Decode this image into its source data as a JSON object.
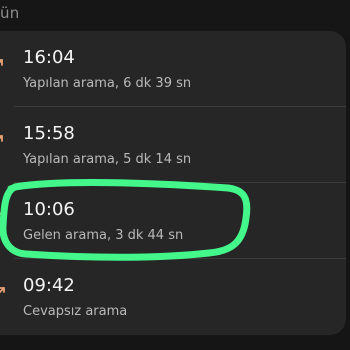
{
  "header": {
    "section_label": "ün"
  },
  "calls": [
    {
      "time": "16:04",
      "detail": "Yapılan arama, 6 dk 39 sn",
      "icon": "outgoing-call-icon"
    },
    {
      "time": "15:58",
      "detail": "Yapılan arama, 5 dk 14 sn",
      "icon": "outgoing-call-icon"
    },
    {
      "time": "10:06",
      "detail": "Gelen arama, 3 dk 44 sn",
      "icon": "incoming-call-icon"
    },
    {
      "time": "09:42",
      "detail": "Cevapsız arama",
      "icon": "missed-call-icon"
    }
  ],
  "colors": {
    "background": "#151515",
    "card": "#262626",
    "primary_text": "#f3f3f3",
    "secondary_text": "#b9b9b9",
    "icon": "#e7a074",
    "highlight": "#43f78b"
  },
  "annotation": {
    "type": "hand-drawn-circle",
    "target": "third-call-row"
  }
}
